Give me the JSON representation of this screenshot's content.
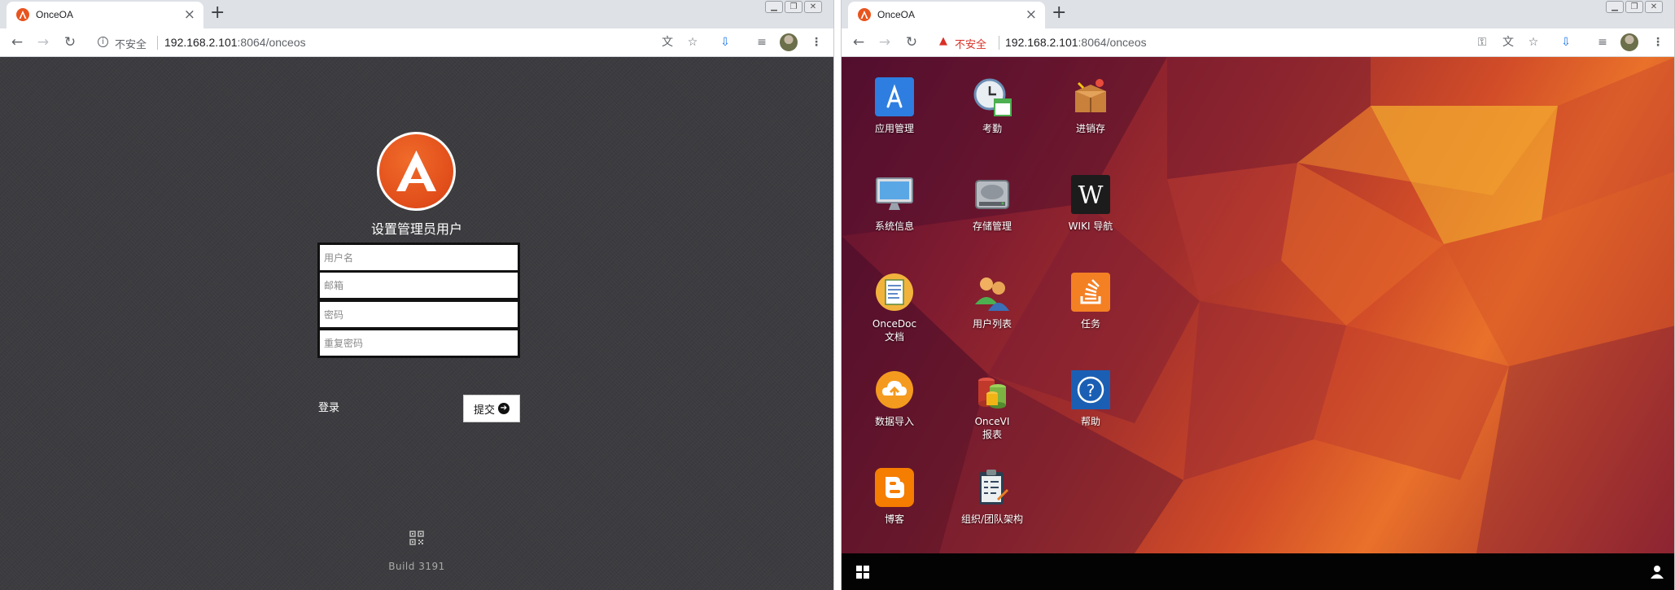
{
  "left_window": {
    "tab_title": "OnceOA",
    "security_text": "不安全",
    "url_host": "192.168.2.101",
    "url_path": ":8064/onceos",
    "setup_title": "设置管理员用户",
    "fields": [
      {
        "placeholder": "用户名"
      },
      {
        "placeholder": "邮箱"
      },
      {
        "placeholder": "密码"
      },
      {
        "placeholder": "重复密码"
      }
    ],
    "login_link": "登录",
    "submit_label": "提交",
    "build": "Build 3191"
  },
  "right_window": {
    "tab_title": "OnceOA",
    "security_text": "不安全",
    "url_host": "192.168.2.101",
    "url_path": ":8064/onceos",
    "desktop_icons": [
      {
        "label": "应用管理",
        "icon": "app-store-icon"
      },
      {
        "label": "考勤",
        "icon": "clock-calendar-icon"
      },
      {
        "label": "进销存",
        "icon": "box-icon"
      },
      {
        "label": "系统信息",
        "icon": "monitor-icon"
      },
      {
        "label": "存储管理",
        "icon": "hard-drive-icon"
      },
      {
        "label": "WIKI 导航",
        "icon": "wikipedia-icon"
      },
      {
        "label": "OnceDoc\n文档",
        "icon": "document-icon"
      },
      {
        "label": "用户列表",
        "icon": "users-icon"
      },
      {
        "label": "任务",
        "icon": "stack-tasks-icon"
      },
      {
        "label": "数据导入",
        "icon": "cloud-upload-icon"
      },
      {
        "label": "OnceVI\n报表",
        "icon": "chart-cylinder-icon"
      },
      {
        "label": "帮助",
        "icon": "help-icon"
      },
      {
        "label": "博客",
        "icon": "blogger-icon"
      },
      {
        "label": "组织/团队架构",
        "icon": "clipboard-icon"
      }
    ]
  }
}
